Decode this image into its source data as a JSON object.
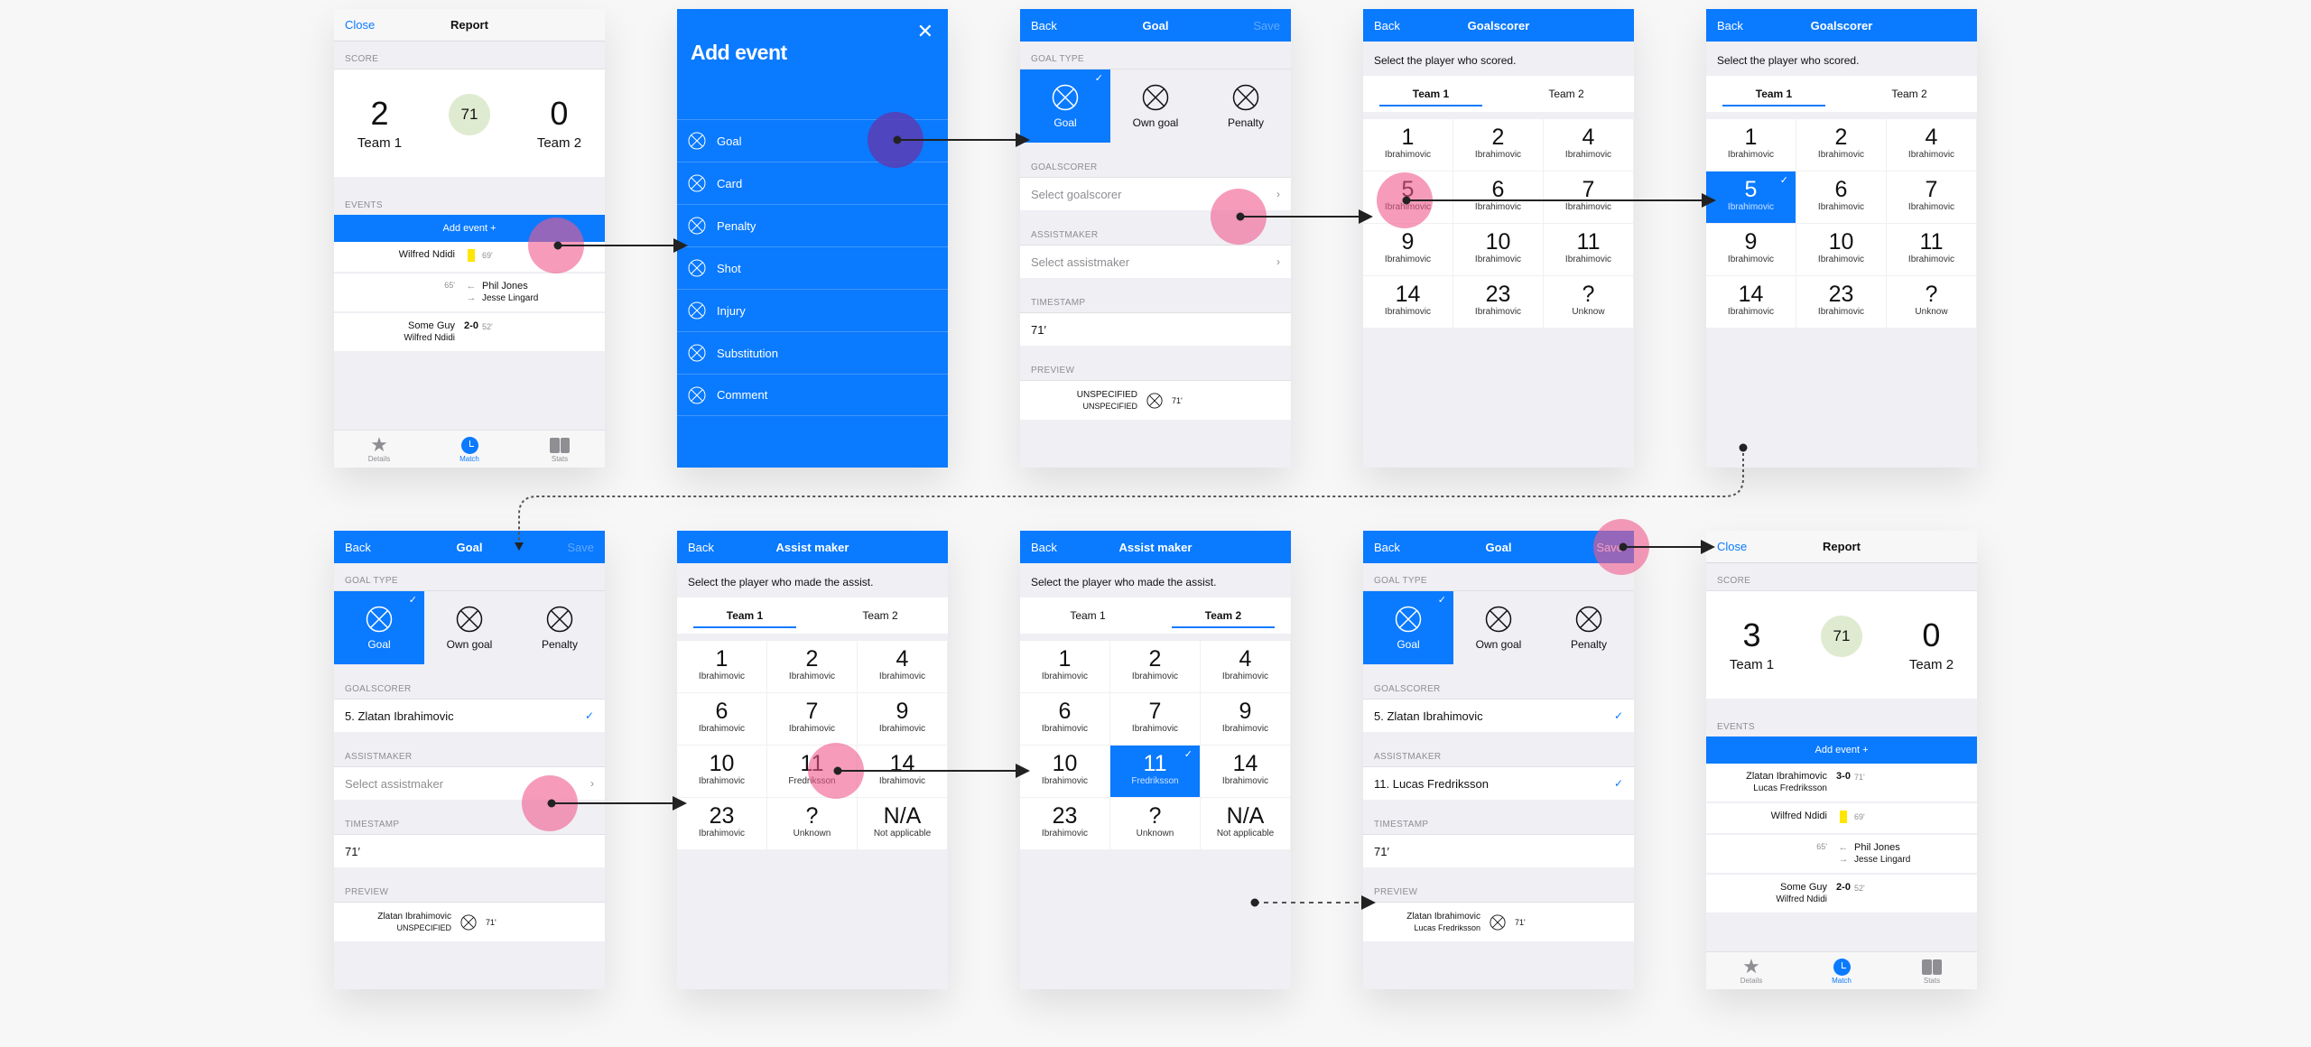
{
  "colors": {
    "accent": "#0a7aff",
    "clock_bg": "#dfebd0",
    "card_yellow": "#ffe600",
    "tap_marker": "#f05a8c"
  },
  "report1": {
    "nav": {
      "left": "Close",
      "title": "Report"
    },
    "score_label": "SCORE",
    "team1": {
      "score": "2",
      "name": "Team 1"
    },
    "minute": "71",
    "team2": {
      "score": "0",
      "name": "Team 2"
    },
    "events_label": "EVENTS",
    "add_event": "Add event  +",
    "events": [
      {
        "type": "card",
        "player": "Wilfred Ndidi",
        "minute": "69'"
      },
      {
        "type": "substitution",
        "minute": "65'",
        "in": "Phil Jones",
        "out": "Jesse Lingard"
      },
      {
        "type": "goal",
        "scorer": "Some Guy",
        "assist": "Wilfred Ndidi",
        "score": "2-0",
        "minute": "52'"
      }
    ],
    "tabs": [
      "Details",
      "Match",
      "Stats"
    ]
  },
  "add_event": {
    "title": "Add event",
    "close": "✕",
    "items": [
      "Goal",
      "Card",
      "Penalty",
      "Shot",
      "Injury",
      "Substitution",
      "Comment"
    ]
  },
  "goal1": {
    "nav": {
      "left": "Back",
      "title": "Goal",
      "right": "Save"
    },
    "goal_type_label": "GOAL TYPE",
    "types": [
      "Goal",
      "Own goal",
      "Penalty"
    ],
    "goalscorer_label": "GOALSCORER",
    "goalscorer_placeholder": "Select goalscorer",
    "assist_label": "ASSISTMAKER",
    "assist_placeholder": "Select assistmaker",
    "timestamp_label": "TIMESTAMP",
    "timestamp": "71′",
    "preview_label": "PREVIEW",
    "preview": {
      "line1": "UNSPECIFIED",
      "line2": "UNSPECIFIED",
      "minute": "71'"
    }
  },
  "goalscorer": {
    "nav": {
      "left": "Back",
      "title": "Goalscorer"
    },
    "hint": "Select the player who scored.",
    "tabs": [
      "Team 1",
      "Team 2"
    ],
    "players": [
      {
        "num": "1",
        "name": "Ibrahimovic"
      },
      {
        "num": "2",
        "name": "Ibrahimovic"
      },
      {
        "num": "4",
        "name": "Ibrahimovic"
      },
      {
        "num": "5",
        "name": "Ibrahimovic"
      },
      {
        "num": "6",
        "name": "Ibrahimovic"
      },
      {
        "num": "7",
        "name": "Ibrahimovic"
      },
      {
        "num": "9",
        "name": "Ibrahimovic"
      },
      {
        "num": "10",
        "name": "Ibrahimovic"
      },
      {
        "num": "11",
        "name": "Ibrahimovic"
      },
      {
        "num": "14",
        "name": "Ibrahimovic"
      },
      {
        "num": "23",
        "name": "Ibrahimovic"
      },
      {
        "num": "?",
        "name": "Unknow"
      }
    ]
  },
  "goal2": {
    "nav": {
      "left": "Back",
      "title": "Goal",
      "right": "Save"
    },
    "goalscorer": "5. Zlatan Ibrahimovic",
    "assist_placeholder": "Select assistmaker",
    "timestamp": "71′",
    "preview": {
      "line1": "Zlatan Ibrahimovic",
      "line2": "UNSPECIFIED",
      "minute": "71'"
    }
  },
  "assist": {
    "nav": {
      "left": "Back",
      "title": "Assist maker"
    },
    "hint": "Select the player who made the assist.",
    "tabs": [
      "Team 1",
      "Team 2"
    ],
    "players": [
      {
        "num": "1",
        "name": "Ibrahimovic"
      },
      {
        "num": "2",
        "name": "Ibrahimovic"
      },
      {
        "num": "4",
        "name": "Ibrahimovic"
      },
      {
        "num": "6",
        "name": "Ibrahimovic"
      },
      {
        "num": "7",
        "name": "Ibrahimovic"
      },
      {
        "num": "9",
        "name": "Ibrahimovic"
      },
      {
        "num": "10",
        "name": "Ibrahimovic"
      },
      {
        "num": "11",
        "name": "Fredriksson"
      },
      {
        "num": "14",
        "name": "Ibrahimovic"
      },
      {
        "num": "23",
        "name": "Ibrahimovic"
      },
      {
        "num": "?",
        "name": "Unknown"
      },
      {
        "num": "N/A",
        "name": "Not applicable"
      }
    ]
  },
  "goal3": {
    "nav": {
      "left": "Back",
      "title": "Goal",
      "right": "Save"
    },
    "goalscorer": "5. Zlatan Ibrahimovic",
    "assist": "11. Lucas Fredriksson",
    "timestamp": "71′",
    "preview": {
      "line1": "Zlatan Ibrahimovic",
      "line2": "Lucas Fredriksson",
      "minute": "71'"
    }
  },
  "report2": {
    "nav": {
      "left": "Close",
      "title": "Report"
    },
    "team1": {
      "score": "3",
      "name": "Team 1"
    },
    "minute": "71",
    "team2": {
      "score": "0",
      "name": "Team 2"
    },
    "new_event": {
      "scorer": "Zlatan Ibrahimovic",
      "assist": "Lucas Fredriksson",
      "score": "3-0",
      "minute": "71'"
    }
  }
}
